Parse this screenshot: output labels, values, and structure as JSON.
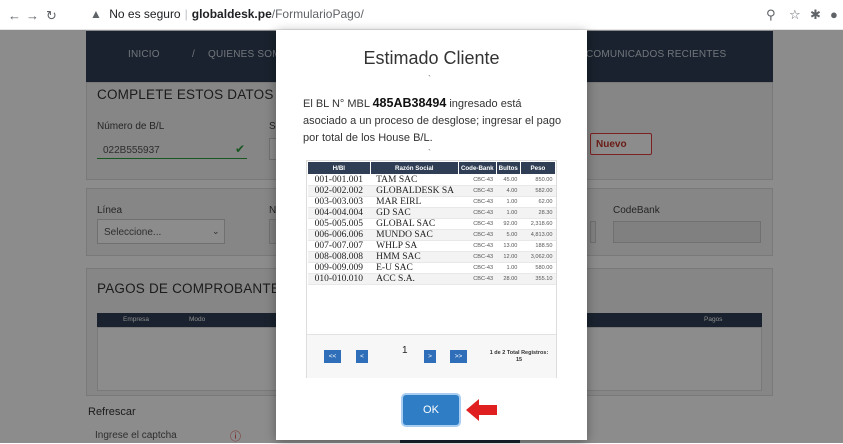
{
  "browser": {
    "security_label": "No es seguro",
    "host": "globaldesk.pe",
    "path": "/FormularioPago/"
  },
  "navbar": {
    "items": [
      "INICIO",
      "/",
      "QUIENES SOMOS",
      "COMUNICADOS RECIENTES"
    ]
  },
  "form": {
    "title": "COMPLETE ESTOS DATOS PAR",
    "bl_label": "Número de B/L",
    "bl_value": "022B555937",
    "nuevo_button": "Nuevo",
    "linea_label": "Línea",
    "linea_value": "Seleccione...",
    "codebank_label": "CodeBank"
  },
  "pagos": {
    "title": "PAGOS DE COMPROBANTES",
    "columns_left": [
      "Empresa",
      "Modo"
    ],
    "columns_right": [
      "Pagos",
      "Información"
    ]
  },
  "footer": {
    "refresh": "Refrescar",
    "captcha": "Ingrese el captcha"
  },
  "modal": {
    "title": "Estimado Cliente",
    "msg_prefix": "El BL N° MBL ",
    "msg_bl": "485AB38494",
    "msg_suffix": " ingresado está asociado a un proceso de desglose; ingresar el pago por total de los House B/L.",
    "table": {
      "headers": [
        "H/Bl",
        "Razón Social",
        "Code-Bank",
        "Bultos",
        "Peso"
      ],
      "rows": [
        [
          "001-001.001",
          "TAM SAC",
          "CBC-43",
          "45.00",
          "850.00"
        ],
        [
          "002-002.002",
          "GLOBALDESK SA",
          "CBC-43",
          "4.00",
          "582.00"
        ],
        [
          "003-003.003",
          "MAR EIRL",
          "CBC-43",
          "1.00",
          "62.00"
        ],
        [
          "004-004.004",
          "GD SAC",
          "CBC-43",
          "1.00",
          "28.30"
        ],
        [
          "005-005.005",
          "GLOBAL SAC",
          "CBC-43",
          "92.00",
          "2,318.60"
        ],
        [
          "006-006.006",
          "MUNDO SAC",
          "CBC-43",
          "5.00",
          "4,813.00"
        ],
        [
          "007-007.007",
          "WHLP SA",
          "CBC-43",
          "13.00",
          "188.50"
        ],
        [
          "008-008.008",
          "HMM SAC",
          "CBC-43",
          "12.00",
          "3,062.00"
        ],
        [
          "009-009.009",
          "E-U SAC",
          "CBC-43",
          "1.00",
          "580.00"
        ],
        [
          "010-010.010",
          "ACC S.A.",
          "CBC-43",
          "28.00",
          "355.10"
        ]
      ]
    },
    "pager": {
      "first": "<<",
      "prev": "<",
      "page": "1",
      "next": ">",
      "last": ">>",
      "info_line1": "1 de 2 Total Registros:",
      "info_line2": "15"
    },
    "ok_button": "OK"
  },
  "colors": {
    "navbar": "#2f3e54",
    "primary": "#2f7ec5",
    "arrow": "#e02020",
    "check": "#2e9e3e"
  }
}
